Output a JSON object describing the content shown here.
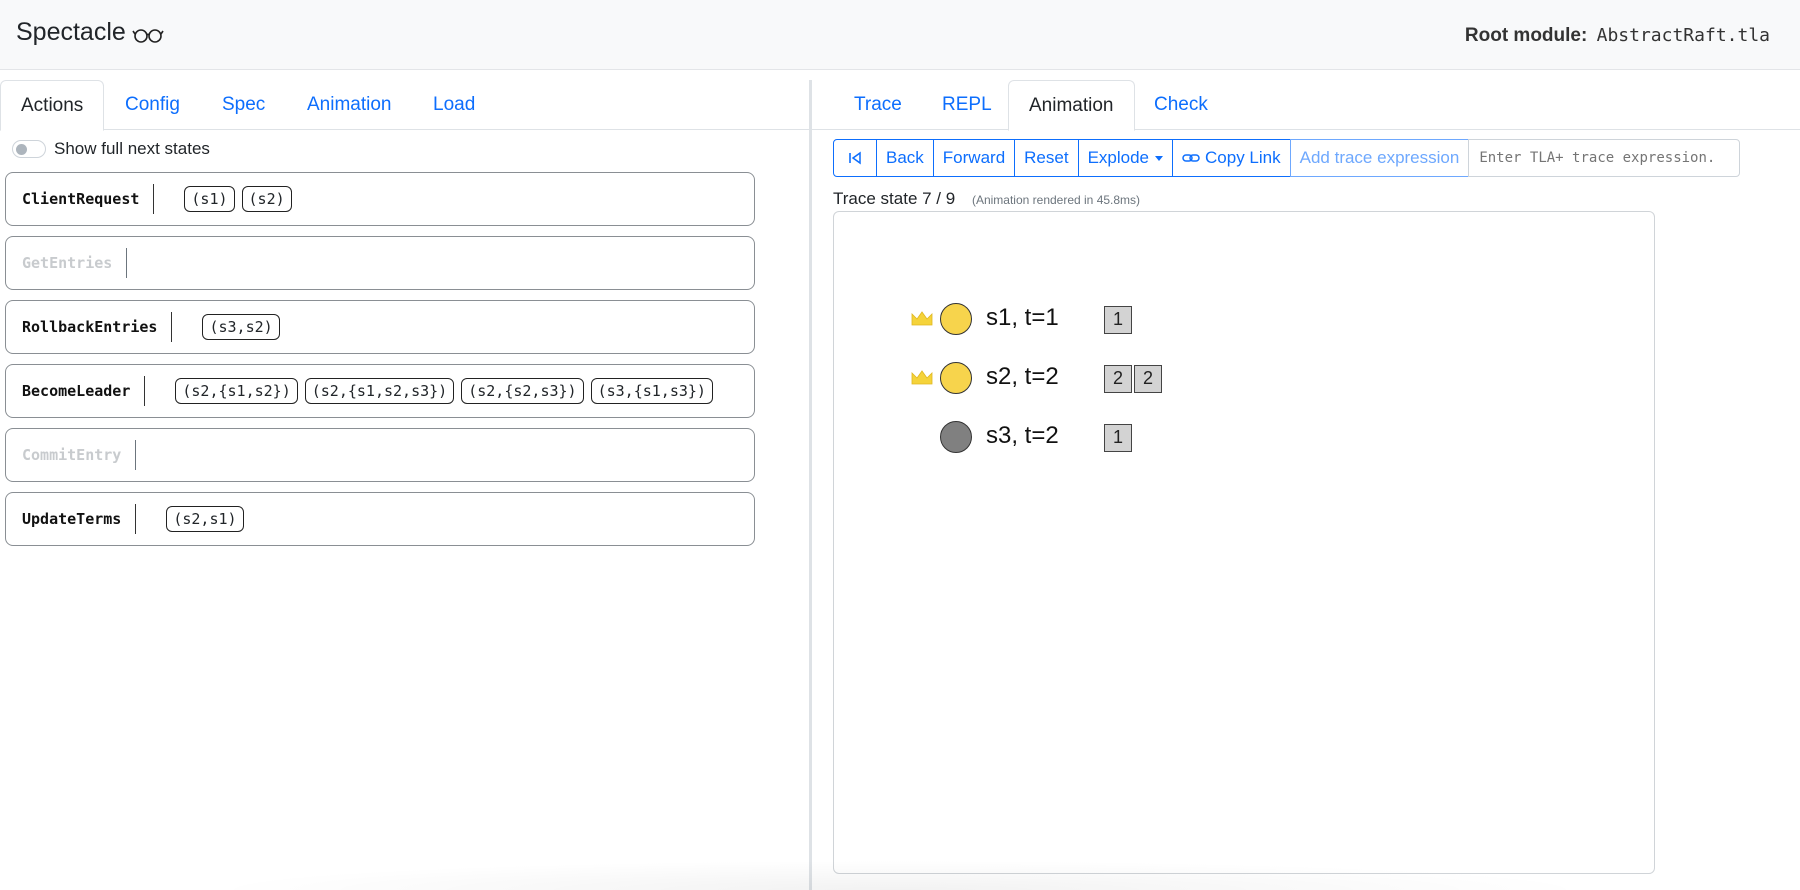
{
  "header": {
    "app_title": "Spectacle",
    "glasses_icon": "glasses-icon",
    "root_module_label": "Root module:",
    "root_module_file": "AbstractRaft.tla"
  },
  "left_tabs": [
    "Actions",
    "Config",
    "Spec",
    "Animation",
    "Load"
  ],
  "left_active_tab": "Actions",
  "toggle": {
    "label": "Show full next states",
    "on": false
  },
  "actions": [
    {
      "name": "ClientRequest",
      "enabled": true,
      "args": [
        "(s1)",
        "(s2)"
      ]
    },
    {
      "name": "GetEntries",
      "enabled": false,
      "args": []
    },
    {
      "name": "RollbackEntries",
      "enabled": true,
      "args": [
        "(s3,s2)"
      ]
    },
    {
      "name": "BecomeLeader",
      "enabled": true,
      "args": [
        "(s2,{s1,s2})",
        "(s2,{s1,s2,s3})",
        "(s2,{s2,s3})",
        "(s3,{s1,s3})"
      ]
    },
    {
      "name": "CommitEntry",
      "enabled": false,
      "args": []
    },
    {
      "name": "UpdateTerms",
      "enabled": true,
      "args": [
        "(s2,s1)"
      ]
    }
  ],
  "right_tabs": [
    "Trace",
    "REPL",
    "Animation",
    "Check"
  ],
  "right_active_tab": "Animation",
  "toolbar": {
    "first_icon": "skip-to-start-icon",
    "back": "Back",
    "forward": "Forward",
    "reset": "Reset",
    "explode": "Explode",
    "copy_link_icon": "link-icon",
    "copy_link": "Copy Link",
    "add_trace_expression": "Add trace expression",
    "trace_input_placeholder": "Enter TLA+ trace expression."
  },
  "trace": {
    "state_text": "Trace state 7 / 9",
    "render_time": "(Animation rendered in 45.8ms)"
  },
  "animation": {
    "nodes": [
      {
        "label": "s1, t=1",
        "leader": true,
        "color": "#f7d44c",
        "log": [
          "1"
        ]
      },
      {
        "label": "s2, t=2",
        "leader": true,
        "color": "#f7d44c",
        "log": [
          "2",
          "2"
        ]
      },
      {
        "label": "s3, t=2",
        "leader": false,
        "color": "#808080",
        "log": [
          "1"
        ]
      }
    ]
  },
  "colors": {
    "link_blue": "#0d6efd",
    "crown_gold": "#f5d33a",
    "entry_gray": "#d3d3d3"
  }
}
